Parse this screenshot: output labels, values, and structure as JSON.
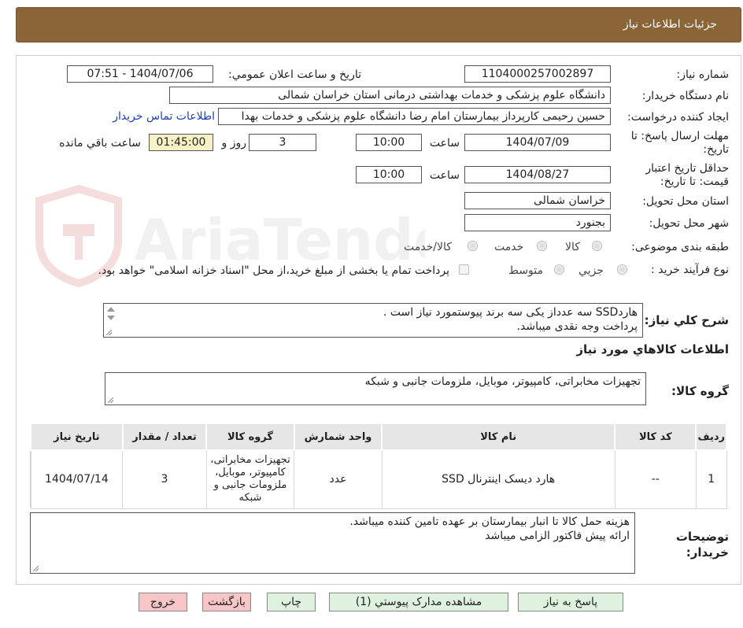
{
  "header": {
    "title": "جزئیات اطلاعات نیاز"
  },
  "watermark": {
    "text": "AriaTender.neT"
  },
  "form": {
    "need_number": {
      "label": "شماره نیاز:",
      "value": "1104000257002897"
    },
    "announce_datetime": {
      "label": "تاریخ و ساعت اعلان عمومي:",
      "value": "1404/07/06 - 07:51"
    },
    "buyer_org": {
      "label": "نام دستگاه خريدار:",
      "value": "دانشگاه علوم پزشکی و خدمات بهداشتی درمانی استان خراسان شمالی"
    },
    "requester": {
      "label": "ايجاد کننده درخواست:",
      "value": "حسین رحیمی کارپرداز بیمارستان امام رضا دانشگاه علوم پزشکی و خدمات بهدا",
      "contact_link": "اطلاعات تماس خريدار"
    },
    "deadline": {
      "label": "مهلت ارسال پاسخ: تا تاریخ:",
      "date": "1404/07/09",
      "time_label": "ساعت",
      "time": "10:00",
      "days": "3",
      "days_label": "روز و",
      "remaining": "01:45:00",
      "remaining_label": "ساعت باقي مانده"
    },
    "price_validity": {
      "label": "حداقل تاريخ اعتبار قيمت: تا تاريخ:",
      "date": "1404/08/27",
      "time_label": "ساعت",
      "time": "10:00"
    },
    "province": {
      "label": "استان محل تحويل:",
      "value": "خراسان شمالی"
    },
    "city": {
      "label": "شهر محل تحويل:",
      "value": "بجنورد"
    },
    "category": {
      "label": "طبقه بندی موضوعی:",
      "options": [
        "کالا",
        "خدمت",
        "کالا/خدمت"
      ]
    },
    "purchase_process": {
      "label": "نوع فرآيند خريد :",
      "options": [
        "جزيي",
        "متوسط"
      ],
      "note": "پرداخت تمام یا بخشی از مبلغ خرید،از محل \"اسناد خزانه اسلامی\" خواهد بود."
    }
  },
  "description": {
    "label": "شرح کلي نياز:",
    "line1": "هاردSSD سه عدداز یکی سه  برند پیوستمورد نیاز است .",
    "line2": "پرداخت وجه نقدی میباشد."
  },
  "goods_section": {
    "title": "اطلاعات کالاهاي مورد نياز",
    "group_label": "گروه کالا:",
    "group_value": "تجهیزات مخابراتی، کامپیوتر، موبایل، ملزومات جانبی و شبکه"
  },
  "table": {
    "headers": [
      "رديف",
      "کد کالا",
      "نام کالا",
      "واحد شمارش",
      "گروه کالا",
      "تعداد / مقدار",
      "تاريخ نياز"
    ],
    "rows": [
      {
        "row": "1",
        "code": "--",
        "name": "هارد دیسک اینترنال SSD",
        "unit": "عدد",
        "group": "تجهیزات مخابراتی، کامپیوتر، موبایل، ملزومات جانبی و شبکه",
        "qty": "3",
        "date": "1404/07/14"
      }
    ]
  },
  "buyer_notes": {
    "label": "توضيحات خريدار:",
    "line1": "هزینه حمل کالا تا انبار بیمارستان بر عهده تامین کننده میباشد.",
    "line2": "ارائه پیش فاکتور الزامی میباشد"
  },
  "buttons": {
    "reply": "پاسخ به نياز",
    "attachments": "مشاهده مدارک پيوستي (1)",
    "print": "چاپ",
    "back": "بازگشت",
    "exit": "خروج"
  },
  "colors": {
    "header_bg": "#8b6538",
    "button_green": "#dff2df",
    "button_pink": "#f8c6c6",
    "remaining_bg": "#f7f2c5",
    "link": "#1a3fb8"
  }
}
